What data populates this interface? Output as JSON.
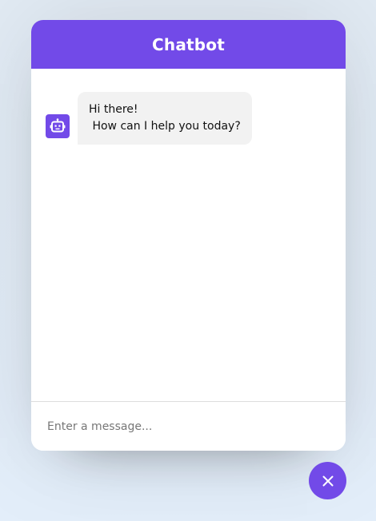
{
  "header": {
    "title": "Chatbot"
  },
  "messages": [
    {
      "sender": "bot",
      "avatar_icon": "robot-icon",
      "text": "Hi there!\n How can I help you today?"
    }
  ],
  "composer": {
    "placeholder": "Enter a message...",
    "value": ""
  },
  "toggler": {
    "icon": "close-icon"
  },
  "colors": {
    "accent": "#724ae8",
    "bubble_bg": "#f2f2f2",
    "page_bg": "#e3eefa"
  }
}
